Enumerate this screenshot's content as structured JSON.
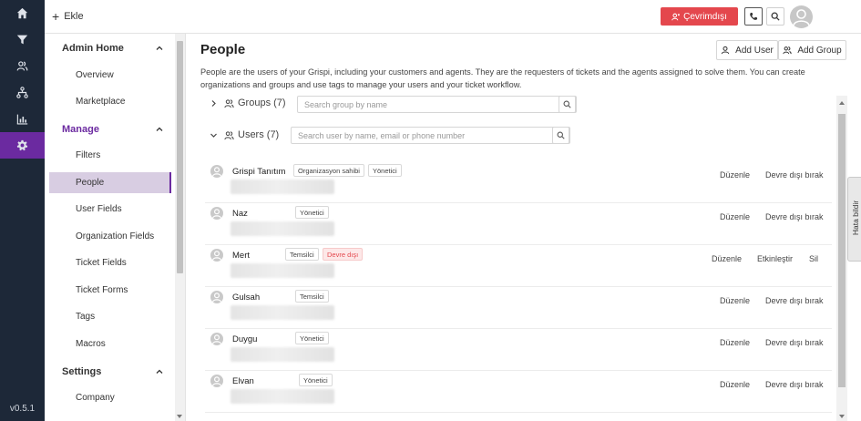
{
  "rail": {
    "items": [
      {
        "icon": "home-icon"
      },
      {
        "icon": "filter-icon"
      },
      {
        "icon": "users-icon"
      },
      {
        "icon": "hierarchy-icon"
      },
      {
        "icon": "chart-icon"
      },
      {
        "icon": "gear-icon"
      }
    ],
    "version": "v0.5.1"
  },
  "topbar": {
    "add_label": "Ekle",
    "status_label": "Çevrimdışı",
    "status_color": "#e4474d"
  },
  "sidebar": {
    "sections": [
      {
        "title": "Admin Home",
        "items": [
          "Overview",
          "Marketplace"
        ]
      },
      {
        "title": "Manage",
        "items": [
          "Filters",
          "People",
          "User Fields",
          "Organization Fields",
          "Ticket Fields",
          "Ticket Forms",
          "Tags",
          "Macros"
        ]
      },
      {
        "title": "Settings",
        "items": [
          "Company"
        ]
      }
    ],
    "active_item": "People",
    "accent_color": "#6b2aa0"
  },
  "main": {
    "title": "People",
    "add_user_label": "Add User",
    "add_group_label": "Add Group",
    "description": "People are the users of your Grispi, including your customers and agents. They are the requesters of tickets and the agents assigned to solve them. You can create organizations and groups and use tags to manage your users and your ticket workflow.",
    "groups": {
      "label": "Groups (7)",
      "search_placeholder": "Search group by name"
    },
    "users": {
      "label": "Users (7)",
      "search_placeholder": "Search user by name, email or phone number"
    },
    "user_list": [
      {
        "name": "Grispi Tanıtım",
        "badges": [
          "Organizasyon sahibi",
          "Yönetici"
        ],
        "actions": [
          "Düzenle",
          "Devre dışı bırak"
        ]
      },
      {
        "name": "Naz",
        "badges": [
          "Yönetici"
        ],
        "actions": [
          "Düzenle",
          "Devre dışı bırak"
        ]
      },
      {
        "name": "Mert",
        "badges": [
          "Temsilci",
          "Devre dışı"
        ],
        "actions": [
          "Düzenle",
          "Etkinleştir",
          "Sil"
        ]
      },
      {
        "name": "Gulsah",
        "badges": [
          "Temsilci"
        ],
        "actions": [
          "Düzenle",
          "Devre dışı bırak"
        ]
      },
      {
        "name": "Duygu",
        "badges": [
          "Yönetici"
        ],
        "actions": [
          "Düzenle",
          "Devre dışı bırak"
        ]
      },
      {
        "name": "Elvan",
        "badges": [
          "Yönetici"
        ],
        "actions": [
          "Düzenle",
          "Devre dışı bırak"
        ]
      }
    ]
  },
  "feedback_tab": "Hata bildir"
}
